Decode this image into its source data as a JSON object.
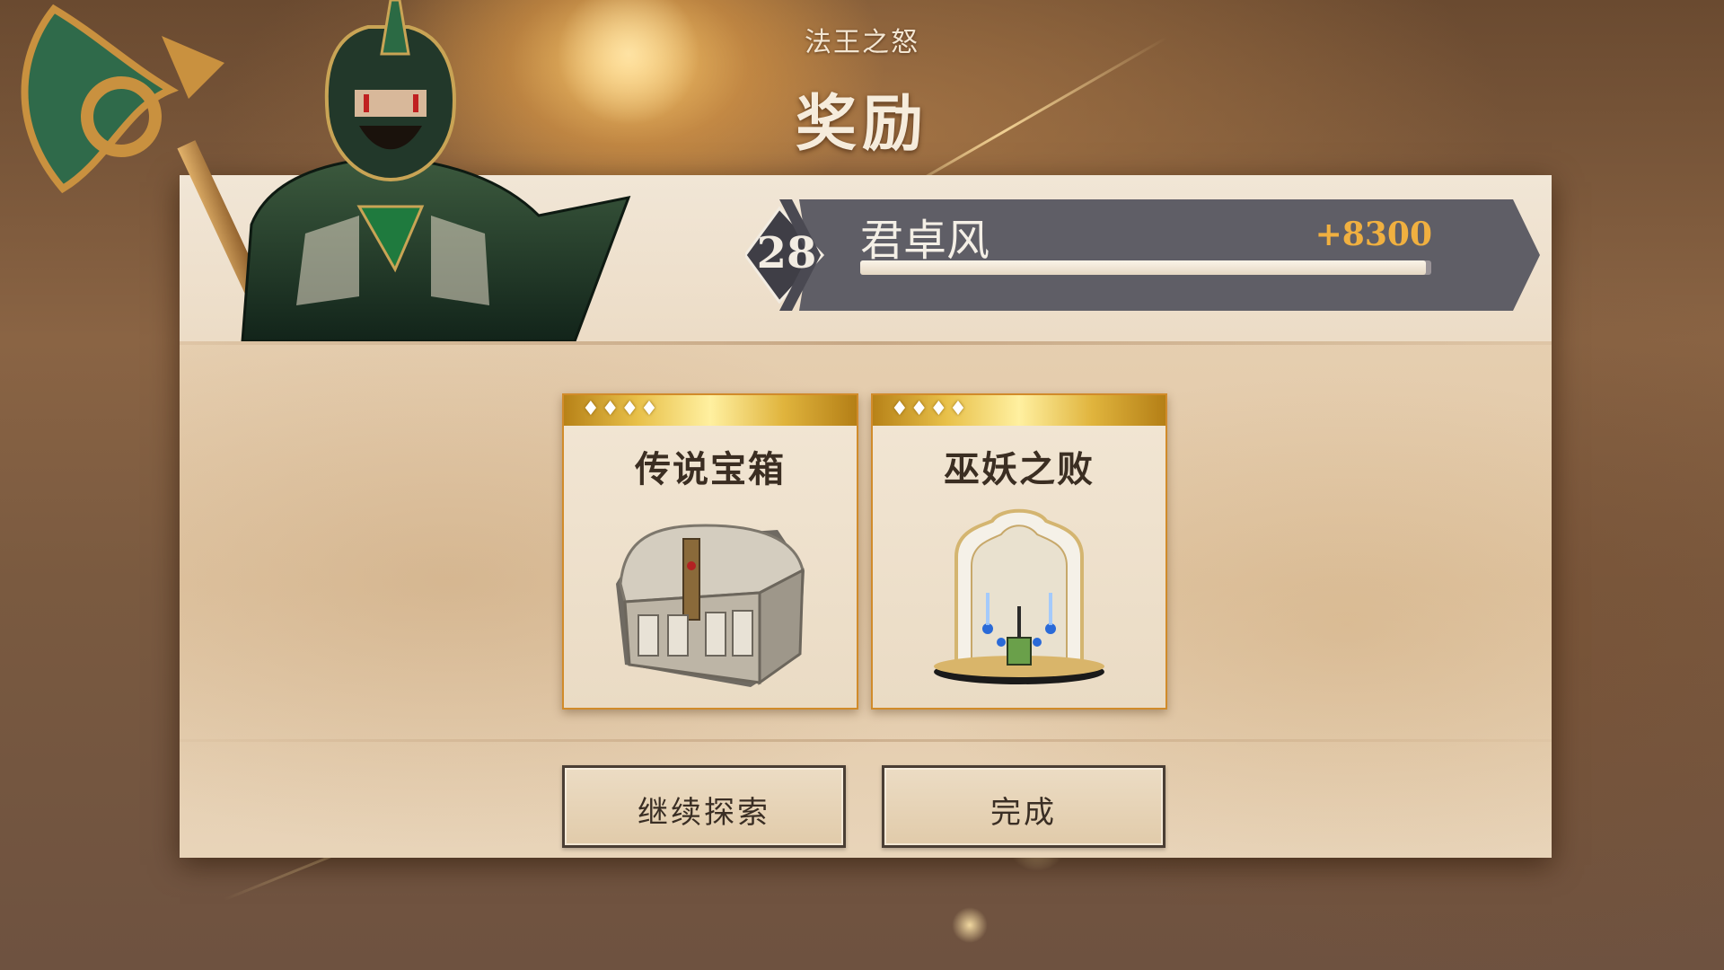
{
  "header": {
    "subtitle": "法王之怒",
    "title": "奖励"
  },
  "player": {
    "level": "28",
    "name": "君卓风",
    "score_gain": "+8300",
    "xp_fill_fraction": 0.99
  },
  "hero": {
    "icon": "armored-warrior-portrait"
  },
  "rewards": [
    {
      "stars": "♦♦♦♦",
      "star_count": 4,
      "title": "传说宝箱",
      "icon": "treasure-chest-icon"
    },
    {
      "stars": "♦♦♦♦",
      "star_count": 4,
      "title": "巫妖之败",
      "icon": "shrine-altar-icon"
    }
  ],
  "buttons": {
    "continue_label": "继续探索",
    "done_label": "完成"
  },
  "colors": {
    "score_gold": "#f0b040",
    "card_border": "#d18b2a",
    "banner_slate": "#5f5e66",
    "parchment": "#e6cfb1"
  }
}
